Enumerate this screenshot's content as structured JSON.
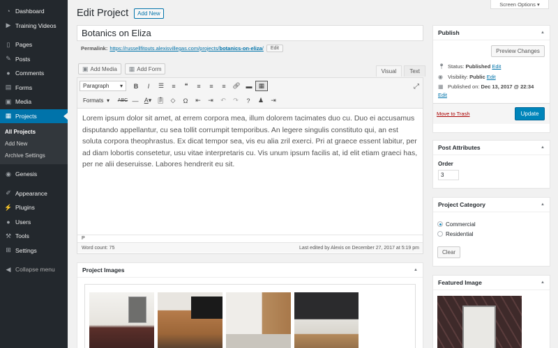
{
  "sidebar": {
    "items": [
      {
        "label": "Dashboard",
        "icon": "dashboard-icon",
        "glyph": "◔"
      },
      {
        "label": "Training Videos",
        "icon": "video-icon",
        "glyph": "▶"
      },
      {
        "label": "Pages",
        "icon": "pages-icon",
        "glyph": "▯"
      },
      {
        "label": "Posts",
        "icon": "pin-icon",
        "glyph": "✎"
      },
      {
        "label": "Comments",
        "icon": "comment-icon",
        "glyph": "●"
      },
      {
        "label": "Forms",
        "icon": "forms-icon",
        "glyph": "▤"
      },
      {
        "label": "Media",
        "icon": "media-icon",
        "glyph": "▣"
      },
      {
        "label": "Projects",
        "icon": "projects-icon",
        "glyph": "▦"
      }
    ],
    "submenu": [
      "All Projects",
      "Add New",
      "Archive Settings"
    ],
    "items2": [
      {
        "label": "Genesis",
        "icon": "genesis-icon",
        "glyph": "◉"
      },
      {
        "label": "Appearance",
        "icon": "brush-icon",
        "glyph": "✐"
      },
      {
        "label": "Plugins",
        "icon": "plugin-icon",
        "glyph": "⚡"
      },
      {
        "label": "Users",
        "icon": "users-icon",
        "glyph": "●"
      },
      {
        "label": "Tools",
        "icon": "wrench-icon",
        "glyph": "⚒"
      },
      {
        "label": "Settings",
        "icon": "settings-icon",
        "glyph": "⊞"
      },
      {
        "label": "Collapse menu",
        "icon": "collapse-icon",
        "glyph": "◀"
      }
    ]
  },
  "header": {
    "title": "Edit Project",
    "add_new": "Add New"
  },
  "post": {
    "title": "Botanics on Eliza",
    "permalink_label": "Permalink:",
    "permalink_base": "https://russellfitouts.alexisvillegas.com/projects/",
    "permalink_slug": "botanics-on-eliza",
    "permalink_end": "/",
    "permalink_edit": "Edit"
  },
  "editor": {
    "add_media": "Add Media",
    "add_form": "Add Form",
    "tab_visual": "Visual",
    "tab_text": "Text",
    "format_select": "Paragraph",
    "formats": "Formats",
    "content": "Lorem ipsum dolor sit amet, at errem corpora mea, illum dolorem tacimates duo cu. Duo ei accusamus disputando appellantur, cu sea tollit corrumpit temporibus. An legere singulis constituto qui, an est soluta corpora theophrastus. Ex dicat tempor sea, vis eu alia zril exerci. Pri at graece essent labitur, per ad diam lobortis consetetur, usu vitae interpretaris cu. Vis unum ipsum facilis at, id elit etiam graeci has, per ne alii deseruisse. Labores hendrerit eu sit.",
    "path": "P",
    "word_count": "Word count: 75",
    "last_edited": "Last edited by Alexis on December 27, 2017 at 5:19 pm"
  },
  "project_images": {
    "title": "Project Images"
  },
  "screen_options": "Screen Options ▾",
  "publish": {
    "title": "Publish",
    "preview": "Preview Changes",
    "status_label": "Status:",
    "status_value": "Published",
    "visibility_label": "Visibility:",
    "visibility_value": "Public",
    "published_label": "Published on:",
    "published_value": "Dec 13, 2017 @ 22:34",
    "edit": "Edit",
    "trash": "Move to Trash",
    "update": "Update"
  },
  "attributes": {
    "title": "Post Attributes",
    "order_label": "Order",
    "order_value": "3"
  },
  "category": {
    "title": "Project Category",
    "options": [
      "Commercial",
      "Residential"
    ],
    "selected": "Commercial",
    "clear": "Clear"
  },
  "featured": {
    "title": "Featured Image"
  }
}
